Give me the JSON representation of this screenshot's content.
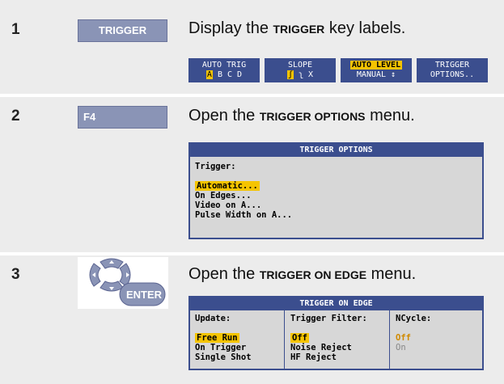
{
  "steps": [
    {
      "number": "1",
      "key_label": "TRIGGER",
      "title_prefix": "Display the ",
      "title_bold": "TRIGGER",
      "title_suffix": " key labels."
    },
    {
      "number": "2",
      "key_label": "F4",
      "title_prefix": "Open the ",
      "title_bold": "TRIGGER OPTIONS",
      "title_suffix": " menu."
    },
    {
      "number": "3",
      "key_label": "ENTER",
      "title_prefix": "Open the ",
      "title_bold": "TRIGGER ON EDGE",
      "title_suffix": " menu."
    }
  ],
  "softkeys": [
    {
      "top": "AUTO TRIG",
      "sel": "A",
      "rest": " B C D"
    },
    {
      "top": "SLOPE",
      "sel": "ʃ",
      "rest": " ʅ X"
    },
    {
      "top": "AUTO LEVEL",
      "sel": "",
      "rest": "MANUAL ↕"
    },
    {
      "top": "TRIGGER",
      "sel": "",
      "rest": "OPTIONS.."
    }
  ],
  "trigger_options_menu": {
    "header": "TRIGGER OPTIONS",
    "label": "Trigger:",
    "items": [
      "Automatic...",
      "On Edges...",
      "Video on A...",
      "Pulse Width on A..."
    ],
    "selected_index": 0
  },
  "trigger_on_edge_menu": {
    "header": "TRIGGER ON EDGE",
    "columns": [
      {
        "label": "Update:",
        "items": [
          "Free Run",
          "On Trigger",
          "Single Shot"
        ],
        "selected_index": 0
      },
      {
        "label": "Trigger Filter:",
        "items": [
          "Off",
          "Noise Reject",
          "HF Reject"
        ],
        "selected_index": 0
      },
      {
        "label": "NCycle:",
        "items": [
          "Off",
          "On"
        ],
        "selected_index": 0
      }
    ]
  },
  "colors": {
    "row_bg": "#ececec",
    "key_bg": "#8a94b6",
    "menu_header": "#3b4e8e",
    "highlight": "#f5c400"
  }
}
